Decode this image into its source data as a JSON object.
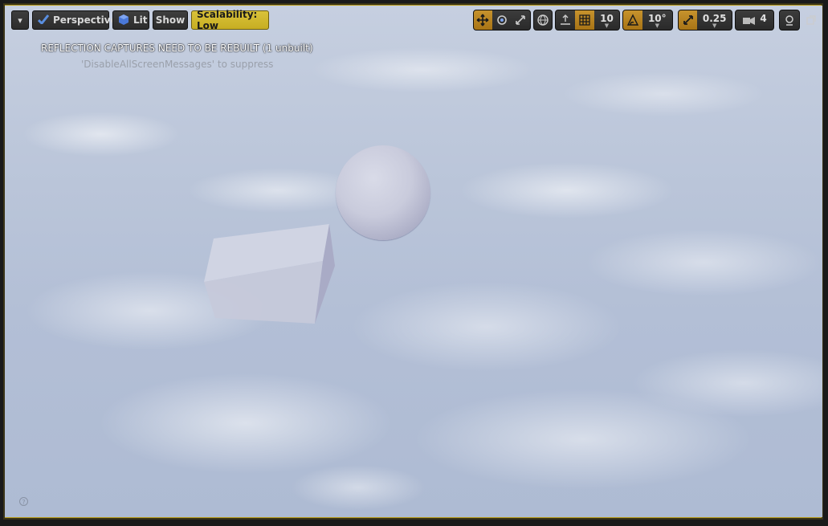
{
  "toolbar": {
    "menu_caret": "▾",
    "perspective_label": "Perspective",
    "lit_label": "Lit",
    "show_label": "Show",
    "scalability_label": "Scalability: Low",
    "grid_snap_value": "10",
    "rotation_snap_value": "10°",
    "scale_snap_value": "0.25",
    "camera_speed_value": "4"
  },
  "icons": {
    "translate": "translate-icon",
    "rotate": "rotate-icon",
    "scale": "scale-icon",
    "world": "world-local-icon",
    "surface_snap": "surface-snap-icon",
    "grid": "grid-snap-icon",
    "rotation": "rotation-snap-icon",
    "scale_snap": "scale-snap-icon",
    "camera": "camera-speed-icon",
    "search": "search-icon",
    "maximize": "maximize-icon",
    "help": "help-icon"
  },
  "messages": {
    "title": "REFLECTION CAPTURES NEED TO BE REBUILT (1 unbuilt)",
    "subtitle": "'DisableAllScreenMessages' to suppress"
  },
  "colors": {
    "active_orange": "#c7932d",
    "scalability_yellow": "#d9c23a",
    "viewport_border": "#b79b1a"
  }
}
